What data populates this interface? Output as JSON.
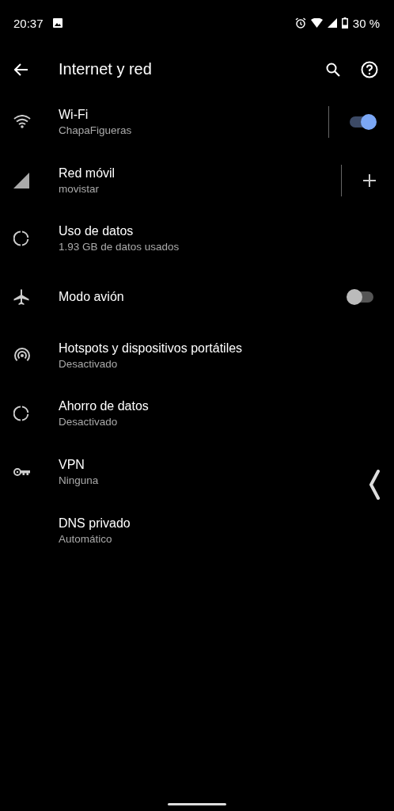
{
  "status_bar": {
    "time": "20:37",
    "battery": "30 %"
  },
  "toolbar": {
    "title": "Internet y red"
  },
  "items": [
    {
      "kind": "wifi",
      "title": "Wi-Fi",
      "summary": "ChapaFigueras",
      "on": true
    },
    {
      "kind": "mobile",
      "title": "Red móvil",
      "summary": "movistar"
    },
    {
      "kind": "data",
      "title": "Uso de datos",
      "summary": "1.93 GB de datos usados"
    },
    {
      "kind": "airplane",
      "title": "Modo avión",
      "on": false
    },
    {
      "kind": "hotspot",
      "title": "Hotspots y dispositivos portátiles",
      "summary": "Desactivado"
    },
    {
      "kind": "data",
      "title": "Ahorro de datos",
      "summary": "Desactivado"
    },
    {
      "kind": "vpn",
      "title": "VPN",
      "summary": "Ninguna"
    },
    {
      "kind": "dns",
      "title": "DNS privado",
      "summary": "Automático"
    }
  ]
}
